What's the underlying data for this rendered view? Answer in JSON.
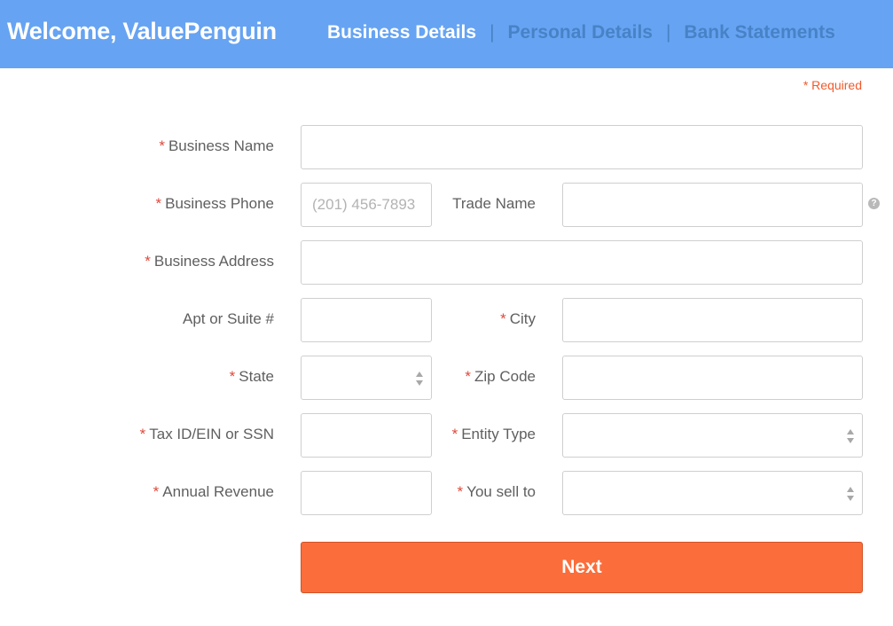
{
  "header": {
    "welcome": "Welcome, ValuePenguin",
    "steps": [
      {
        "label": "Business Details",
        "active": true
      },
      {
        "label": "Personal Details",
        "active": false
      },
      {
        "label": "Bank Statements",
        "active": false
      }
    ],
    "separator": "|"
  },
  "form": {
    "required_note": "* Required",
    "required_marker": "*",
    "business_name": {
      "label": "Business Name",
      "value": ""
    },
    "business_phone": {
      "label": "Business Phone",
      "value": "",
      "placeholder": "(201) 456-7893"
    },
    "trade_name": {
      "label": "Trade Name",
      "value": ""
    },
    "business_address": {
      "label": "Business Address",
      "value": ""
    },
    "apt_suite": {
      "label": "Apt or Suite #",
      "value": ""
    },
    "city": {
      "label": "City",
      "value": ""
    },
    "state": {
      "label": "State",
      "value": ""
    },
    "zip_code": {
      "label": "Zip Code",
      "value": ""
    },
    "tax_id": {
      "label": "Tax ID/EIN or SSN",
      "value": ""
    },
    "entity_type": {
      "label": "Entity Type",
      "value": ""
    },
    "annual_revenue": {
      "label": "Annual Revenue",
      "value": ""
    },
    "you_sell_to": {
      "label": "You sell to",
      "value": ""
    },
    "help_icon": "?",
    "next_label": "Next"
  },
  "colors": {
    "header_bg": "#66a3f2",
    "accent": "#fb6d3a",
    "required": "#e0483a"
  },
  "icons": [
    "question-circle-icon",
    "select-arrows-icon"
  ]
}
